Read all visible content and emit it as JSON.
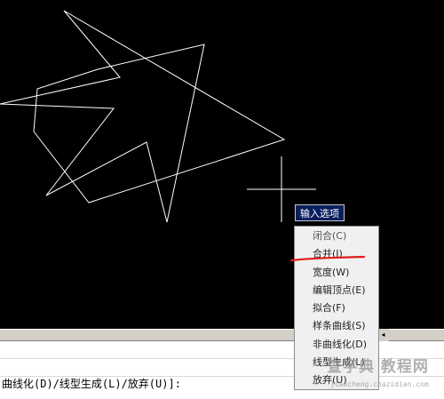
{
  "tooltip": {
    "label": "输入选项"
  },
  "menu": {
    "items": [
      {
        "label": "闭合(C)"
      },
      {
        "label": "合并(J)"
      },
      {
        "label": "宽度(W)"
      },
      {
        "label": "编辑顶点(E)"
      },
      {
        "label": "拟合(F)"
      },
      {
        "label": "样条曲线(S)"
      },
      {
        "label": "非曲线化(D)"
      },
      {
        "label": "线型生成(L)"
      },
      {
        "label": "放弃(U)"
      }
    ]
  },
  "scrollbar": {
    "left_arrow": "◂"
  },
  "command_line": {
    "prompt": "曲线化(D)/线型生成(L)/放弃(U)]:"
  },
  "watermark": {
    "text": "查字典 教程网",
    "url": "jiaocheng.chazidian.com"
  },
  "colors": {
    "drawing_lines": "#ffffff",
    "canvas": "#000000",
    "annotation": "#e21b1b",
    "tooltip_bg": "#0a1f5e"
  }
}
